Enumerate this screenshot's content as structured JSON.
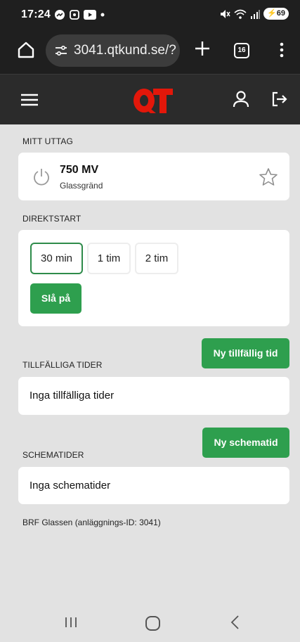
{
  "status_bar": {
    "time": "17:24",
    "battery": "69",
    "left_icons": [
      "messenger-icon",
      "screenshot-icon",
      "youtube-icon",
      "dot-icon"
    ],
    "right_icons": [
      "mute-icon",
      "wifi-icon",
      "signal-icon"
    ]
  },
  "browser": {
    "url": "3041.qtkund.se/?",
    "tab_count": "16"
  },
  "app_header": {
    "logo_text": "QT",
    "brand_color": "#e3170a"
  },
  "mitt_uttag": {
    "label": "MITT UTTAG",
    "name": "750 MV",
    "location": "Glassgränd"
  },
  "direktstart": {
    "label": "DIREKTSTART",
    "durations": [
      "30 min",
      "1 tim",
      "2 tim"
    ],
    "selected": "30 min",
    "start_button": "Slå på"
  },
  "tillfalliga": {
    "label": "TILLFÄLLIGA TIDER",
    "new_button": "Ny tillfällig tid",
    "empty_text": "Inga tillfälliga tider"
  },
  "schematider": {
    "label": "SCHEMATIDER",
    "new_button": "Ny schematid",
    "empty_text": "Inga schematider"
  },
  "footer": {
    "facility": "BRF Glassen (anläggnings-ID: 3041)"
  },
  "colors": {
    "accent_green": "#2e9f4e",
    "selected_border": "#2e8b4a",
    "header_bg": "#2b2b2b",
    "content_bg": "#e2e2e2"
  }
}
